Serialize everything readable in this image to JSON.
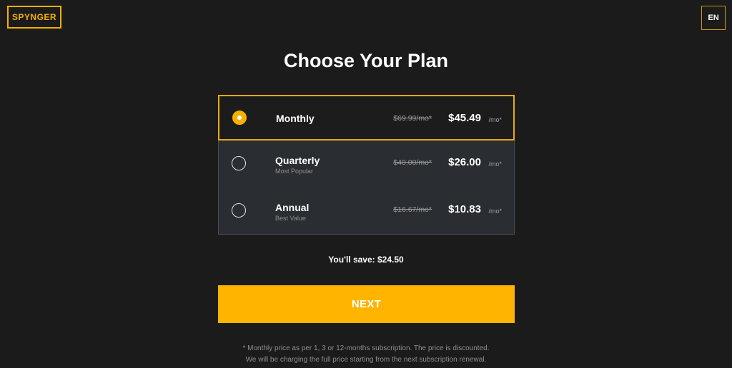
{
  "header": {
    "logo": "SPYNGER",
    "language": "EN"
  },
  "main": {
    "title": "Choose Your Plan",
    "plans": [
      {
        "name": "Monthly",
        "subtitle": "",
        "old_price": "$69.99/mo*",
        "price": "$45.49",
        "per": "/mo*",
        "selected": true
      },
      {
        "name": "Quarterly",
        "subtitle": "Most Popular",
        "old_price": "$40.00/mo*",
        "price": "$26.00",
        "per": "/mo*",
        "selected": false
      },
      {
        "name": "Annual",
        "subtitle": "Best Value",
        "old_price": "$16.67/mo*",
        "price": "$10.83",
        "per": "/mo*",
        "selected": false
      }
    ],
    "savings": "You'll save: $24.50",
    "next_label": "NEXT",
    "footnote_line1": "* Monthly price as per 1, 3 or 12-months subscription. The price is discounted.",
    "footnote_line2": "We will be charging the full price starting from the next subscription renewal."
  },
  "colors": {
    "background": "#1b1b1b",
    "accent": "#ffb400",
    "panel": "#2a2d32"
  }
}
